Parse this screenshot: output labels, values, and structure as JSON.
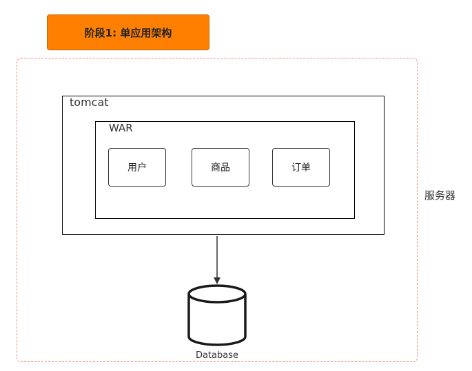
{
  "stage_title": "阶段1: 单应用架构",
  "server": {
    "label": "服务器"
  },
  "tomcat": {
    "label": "tomcat"
  },
  "war": {
    "label": "WAR",
    "modules": [
      {
        "label": "用户"
      },
      {
        "label": "商品"
      },
      {
        "label": "订单"
      }
    ]
  },
  "database": {
    "label": "Database"
  },
  "colors": {
    "banner_fill": "#ff8000",
    "server_border": "#f08a8a",
    "box_border": "#000000"
  }
}
